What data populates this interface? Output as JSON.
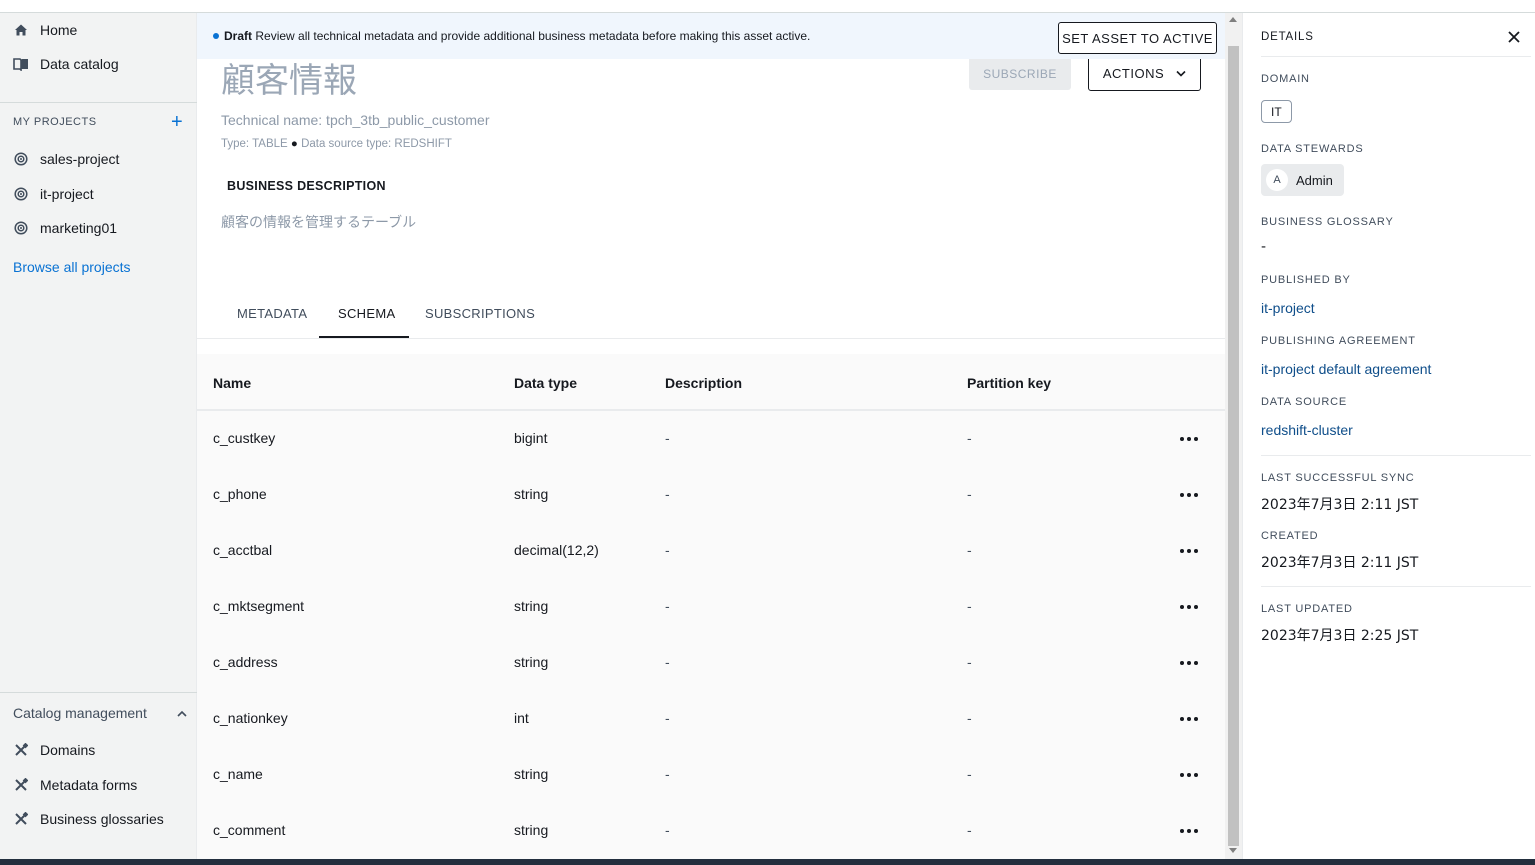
{
  "sidebar": {
    "nav": [
      {
        "label": "Home",
        "icon": "home-icon"
      },
      {
        "label": "Data catalog",
        "icon": "book-icon"
      }
    ],
    "my_projects_heading": "MY PROJECTS",
    "projects": [
      "sales-project",
      "it-project",
      "marketing01"
    ],
    "browse_all": "Browse all projects",
    "catalog_management": {
      "label": "Catalog management",
      "items": [
        "Domains",
        "Metadata forms",
        "Business glossaries"
      ]
    }
  },
  "banner": {
    "status": "Draft",
    "message": "Review all technical metadata and provide additional business metadata before making this asset active.",
    "action": "SET ASSET TO ACTIVE"
  },
  "asset": {
    "title": "顧客情報",
    "technical_name": "Technical name: tpch_3tb_public_customer",
    "type_line": "Type: TABLE",
    "source_type": "Data source type: REDSHIFT",
    "subscribe": "SUBSCRIBE",
    "actions": "ACTIONS",
    "business_description_heading": "BUSINESS DESCRIPTION",
    "business_description": "顧客の情報を管理するテーブル"
  },
  "tabs": [
    "METADATA",
    "SCHEMA",
    "SUBSCRIPTIONS"
  ],
  "active_tab": "SCHEMA",
  "schema": {
    "columns": [
      "Name",
      "Data type",
      "Description",
      "Partition key"
    ],
    "rows": [
      {
        "name": "c_custkey",
        "type": "bigint",
        "description": "-",
        "partition": "-"
      },
      {
        "name": "c_phone",
        "type": "string",
        "description": "-",
        "partition": "-"
      },
      {
        "name": "c_acctbal",
        "type": "decimal(12,2)",
        "description": "-",
        "partition": "-"
      },
      {
        "name": "c_mktsegment",
        "type": "string",
        "description": "-",
        "partition": "-"
      },
      {
        "name": "c_address",
        "type": "string",
        "description": "-",
        "partition": "-"
      },
      {
        "name": "c_nationkey",
        "type": "int",
        "description": "-",
        "partition": "-"
      },
      {
        "name": "c_name",
        "type": "string",
        "description": "-",
        "partition": "-"
      },
      {
        "name": "c_comment",
        "type": "string",
        "description": "-",
        "partition": "-"
      }
    ]
  },
  "details": {
    "title": "DETAILS",
    "domain_label": "DOMAIN",
    "domain": "IT",
    "stewards_label": "DATA STEWARDS",
    "steward_initial": "A",
    "steward_name": "Admin",
    "glossary_label": "BUSINESS GLOSSARY",
    "glossary": "-",
    "published_by_label": "PUBLISHED BY",
    "published_by": "it-project",
    "agreement_label": "PUBLISHING AGREEMENT",
    "agreement": "it-project default agreement",
    "source_label": "DATA SOURCE",
    "source": "redshift-cluster",
    "last_sync_label": "LAST SUCCESSFUL SYNC",
    "last_sync": "2023年7月3日 2:11 JST",
    "created_label": "CREATED",
    "created": "2023年7月3日 2:11 JST",
    "updated_label": "LAST UPDATED",
    "updated": "2023年7月3日 2:25 JST"
  },
  "colors": {
    "accent": "#0972d3",
    "link": "#0f4e8a",
    "banner": "#f0f6fd"
  }
}
